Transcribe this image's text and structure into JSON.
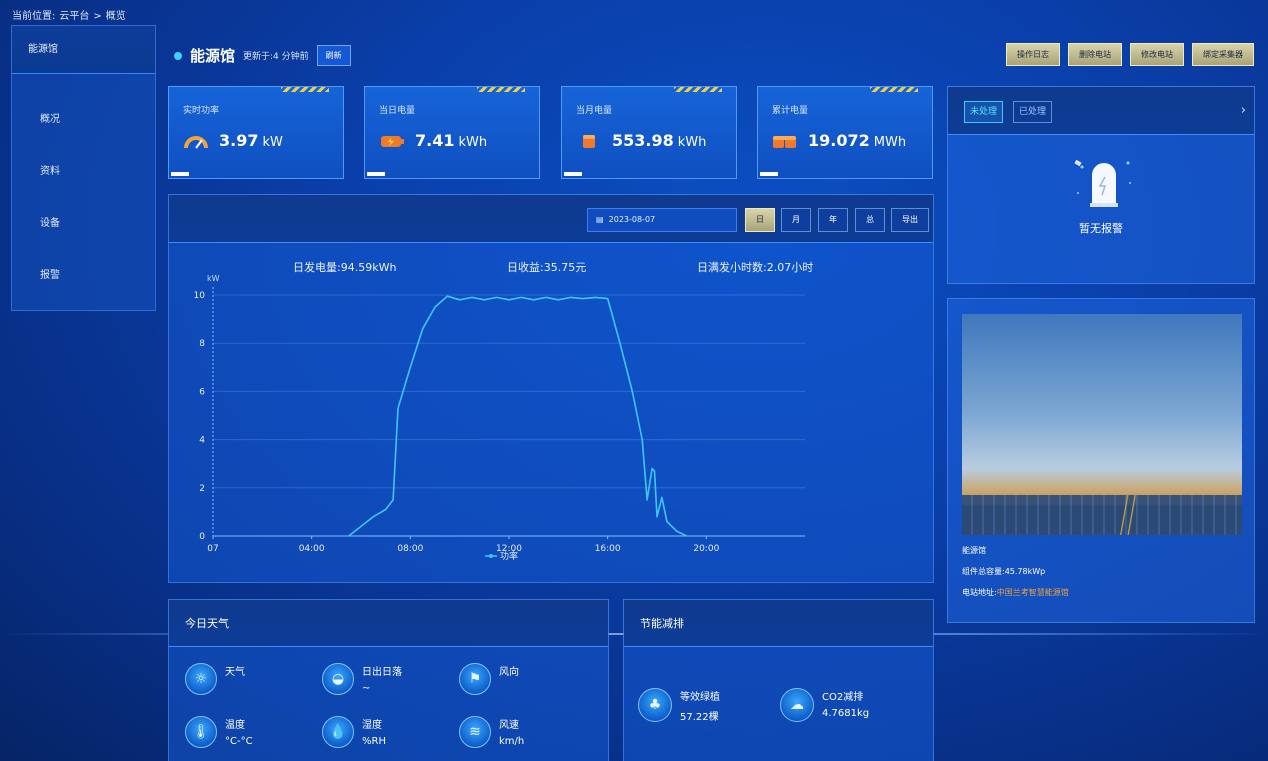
{
  "breadcrumb": {
    "prefix": "当前位置:",
    "parent": "云平台",
    "sep": ">",
    "current": "概览"
  },
  "sidebar": {
    "title": "能源馆",
    "items": [
      {
        "label": "概况"
      },
      {
        "label": "资料"
      },
      {
        "label": "设备"
      },
      {
        "label": "报警"
      }
    ]
  },
  "header": {
    "station_name": "能源馆",
    "updated": "更新于:4 分钟前",
    "refresh_label": "刷新",
    "actions": [
      "操作日志",
      "删除电站",
      "修改电站",
      "绑定采集器"
    ]
  },
  "kpis": [
    {
      "label": "实时功率",
      "value": "3.97",
      "unit": "kW",
      "icon": "gauge-icon"
    },
    {
      "label": "当日电量",
      "value": "7.41",
      "unit": "kWh",
      "icon": "battery-icon"
    },
    {
      "label": "当月电量",
      "value": "553.98",
      "unit": "kWh",
      "icon": "battery-stack-icon"
    },
    {
      "label": "累计电量",
      "value": "19.072",
      "unit": "MWh",
      "icon": "battery-stack-icon"
    }
  ],
  "chart_toolbar": {
    "date": "2023-08-07",
    "ranges": [
      "日",
      "月",
      "年",
      "总"
    ],
    "active_range": "日",
    "export_label": "导出"
  },
  "stats": {
    "daily_gen": "日发电量:94.59kWh",
    "daily_income": "日收益:35.75元",
    "full_hours": "日满发小时数:2.07小时"
  },
  "chart_data": {
    "type": "line",
    "title": "",
    "ylabel": "kW",
    "xlabel": "",
    "ylim": [
      0,
      10
    ],
    "yticks": [
      0,
      2,
      4,
      6,
      8,
      10
    ],
    "xticks": [
      "07",
      "04:00",
      "08:00",
      "12:00",
      "16:00",
      "20:00"
    ],
    "xlim_hours": [
      0,
      24
    ],
    "legend": "bottom-center",
    "grid": true,
    "series": [
      {
        "name": "功率",
        "color": "#3ec6ff",
        "points": [
          [
            5.5,
            0
          ],
          [
            6.0,
            0.4
          ],
          [
            6.5,
            0.8
          ],
          [
            7.0,
            1.1
          ],
          [
            7.3,
            1.5
          ],
          [
            7.5,
            5.3
          ],
          [
            8.0,
            7.0
          ],
          [
            8.5,
            8.6
          ],
          [
            9.0,
            9.5
          ],
          [
            9.5,
            9.95
          ],
          [
            10.0,
            9.8
          ],
          [
            10.5,
            9.9
          ],
          [
            11.0,
            9.8
          ],
          [
            11.5,
            9.9
          ],
          [
            12.0,
            9.8
          ],
          [
            12.5,
            9.9
          ],
          [
            13.0,
            9.8
          ],
          [
            13.5,
            9.9
          ],
          [
            14.0,
            9.8
          ],
          [
            14.5,
            9.9
          ],
          [
            15.0,
            9.85
          ],
          [
            15.5,
            9.9
          ],
          [
            16.0,
            9.85
          ],
          [
            16.5,
            8.0
          ],
          [
            17.0,
            6.0
          ],
          [
            17.4,
            4.0
          ],
          [
            17.6,
            1.5
          ],
          [
            17.8,
            2.8
          ],
          [
            17.9,
            2.7
          ],
          [
            18.0,
            0.8
          ],
          [
            18.2,
            1.6
          ],
          [
            18.4,
            0.6
          ],
          [
            18.8,
            0.2
          ],
          [
            19.2,
            0
          ]
        ]
      }
    ]
  },
  "alarms": {
    "tabs": [
      "未处理",
      "已处理"
    ],
    "active_tab": "未处理",
    "empty_text": "暂无报警"
  },
  "station_info": {
    "name": "能源馆",
    "capacity": "组件总容量:45.78kWp",
    "address_label": "电站地址:",
    "address": "中国兰考智慧能源馆"
  },
  "weather": {
    "title": "今日天气",
    "items": [
      {
        "label": "天气",
        "value": "",
        "icon": "sun-icon"
      },
      {
        "label": "日出日落",
        "value": "~",
        "icon": "sunrise-icon"
      },
      {
        "label": "风向",
        "value": "",
        "icon": "windsock-icon"
      },
      {
        "label": "温度",
        "value": "°C-°C",
        "icon": "thermometer-icon"
      },
      {
        "label": "湿度",
        "value": "%RH",
        "icon": "droplet-icon"
      },
      {
        "label": "风速",
        "value": "km/h",
        "icon": "wind-icon"
      }
    ]
  },
  "savings": {
    "title": "节能减排",
    "items": [
      {
        "label": "等效绿植",
        "value": "57.22棵",
        "icon": "tree-icon"
      },
      {
        "label": "CO2减排",
        "value": "4.7681kg",
        "icon": "co2-cloud-icon"
      }
    ]
  }
}
